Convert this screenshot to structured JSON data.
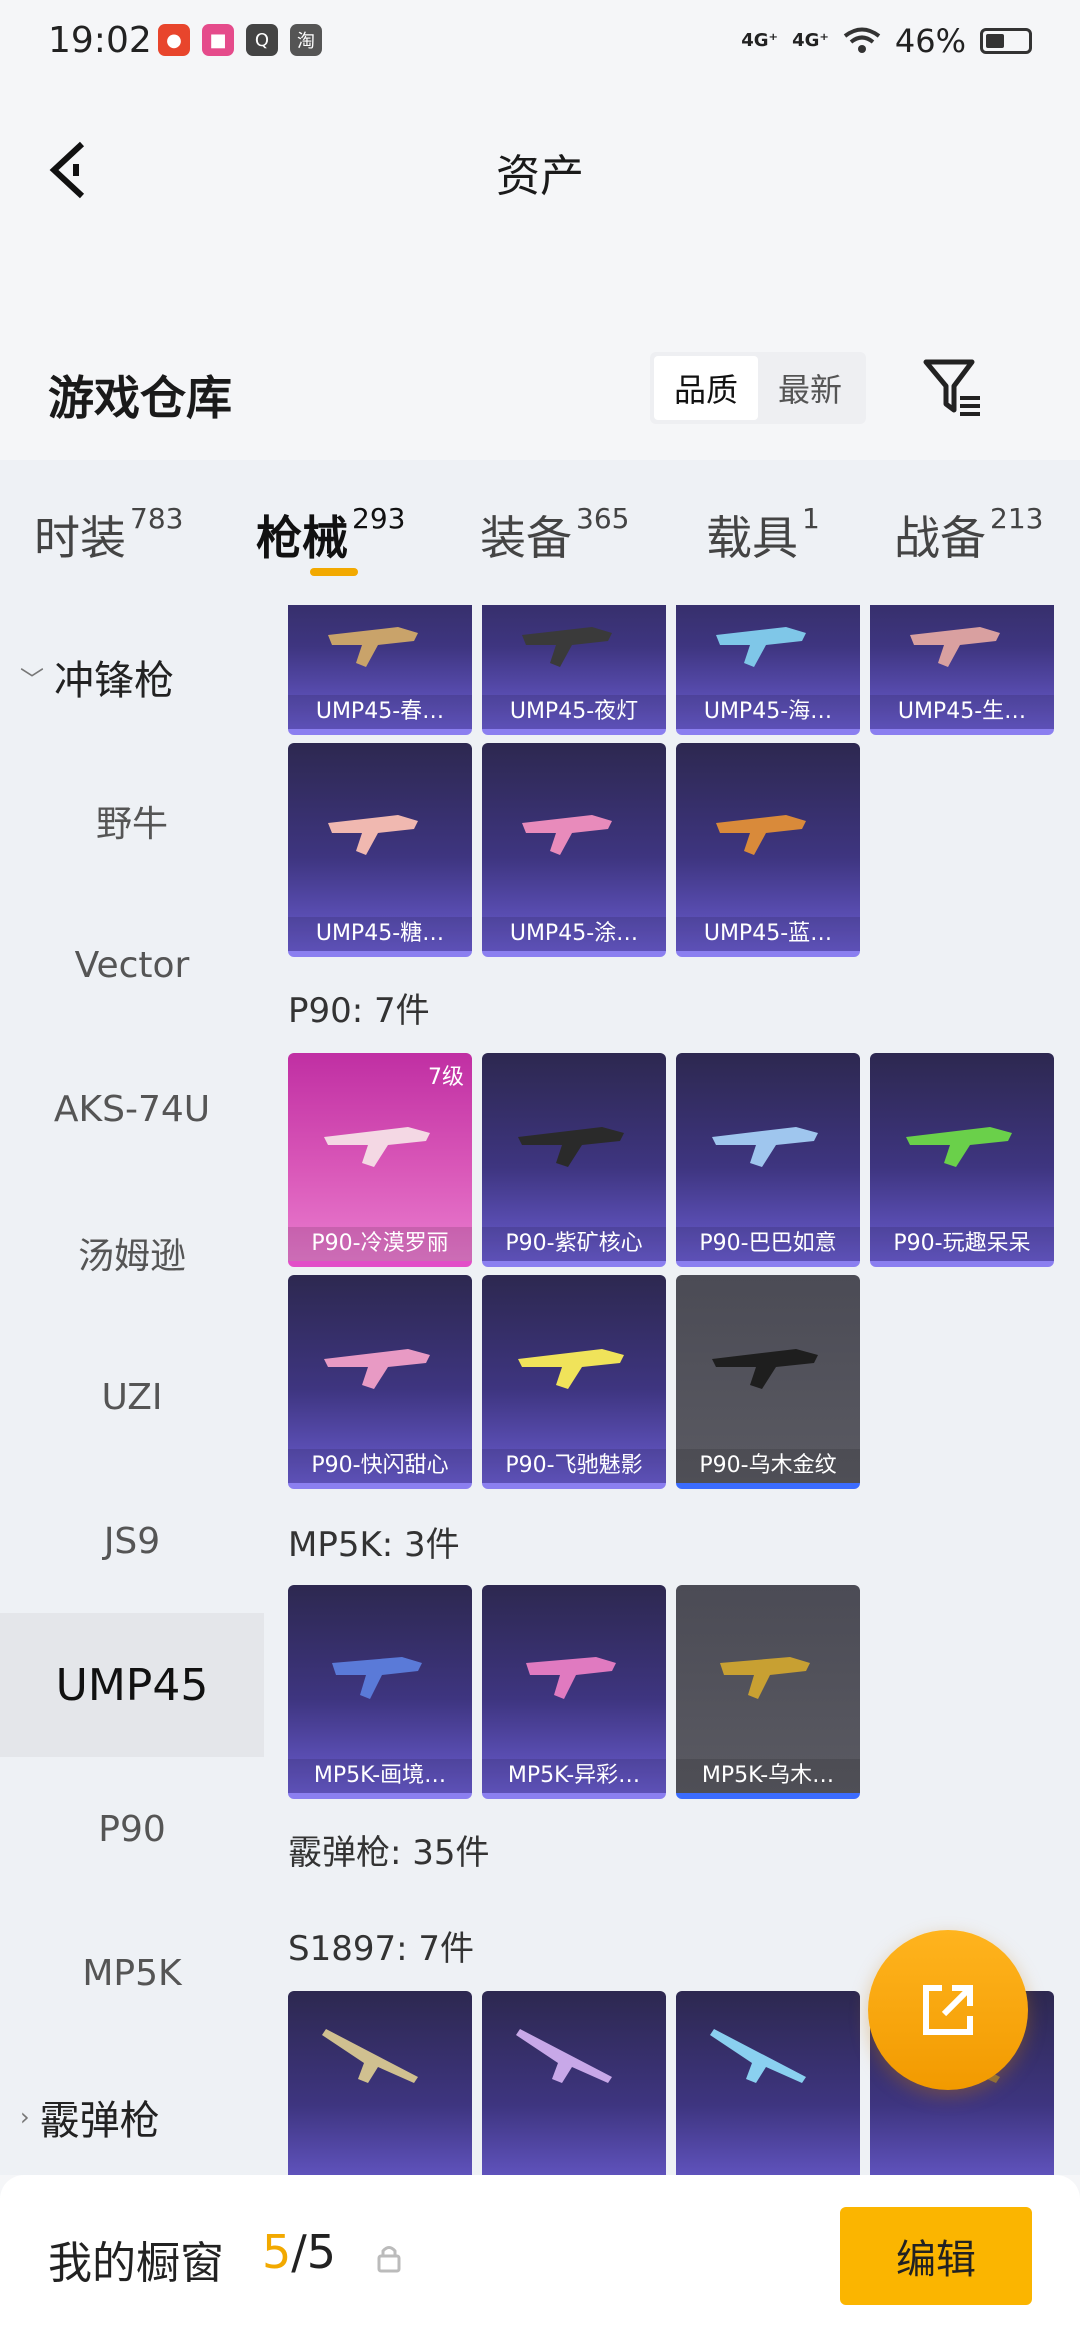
{
  "status_bar": {
    "time": "19:02",
    "net1": "4G⁺",
    "net2": "4G⁺",
    "battery": "46%",
    "battery_level": 0.46
  },
  "header": {
    "title": "资产"
  },
  "warehouse": {
    "title": "游戏仓库",
    "sort_options": [
      "品质",
      "最新"
    ]
  },
  "tabs": [
    {
      "label": "时装",
      "count": "783"
    },
    {
      "label": "枪械",
      "count": "293"
    },
    {
      "label": "装备",
      "count": "365"
    },
    {
      "label": "载具",
      "count": "1"
    },
    {
      "label": "战备",
      "count": "213"
    }
  ],
  "sidebar": {
    "group_smg": "冲锋枪",
    "items": [
      "野牛",
      "Vector",
      "AKS-74U",
      "汤姆逊",
      "UZI",
      "JS9",
      "UMP45",
      "P90",
      "MP5K"
    ],
    "group_shotgun": "霰弹枪"
  },
  "content": {
    "ump_row1": [
      "UMP45-春…",
      "UMP45-夜灯",
      "UMP45-海…",
      "UMP45-生…"
    ],
    "ump_row2": [
      "UMP45-糖…",
      "UMP45-涂…",
      "UMP45-蓝…"
    ],
    "p90_label": "P90: 7件",
    "p90_row1": [
      "P90-冷漠罗丽",
      "P90-紫矿核心",
      "P90-巴巴如意",
      "P90-玩趣呆呆"
    ],
    "p90_level": "7级",
    "p90_row2": [
      "P90-快闪甜心",
      "P90-飞驰魅影",
      "P90-乌木金纹"
    ],
    "mp5k_label": "MP5K: 3件",
    "mp5k_row": [
      "MP5K-画境…",
      "MP5K-异彩…",
      "MP5K-乌木…"
    ],
    "shotgun_label": "霰弹枪: 35件",
    "s1897_label": "S1897: 7件"
  },
  "bottom_bar": {
    "title": "我的橱窗",
    "current": "5",
    "total": "/5",
    "edit_label": "编辑"
  },
  "colors": {
    "accent": "#f2a900",
    "card_purple": "#3e3580",
    "card_pink": "#d957b8",
    "card_grey": "#55555d"
  }
}
